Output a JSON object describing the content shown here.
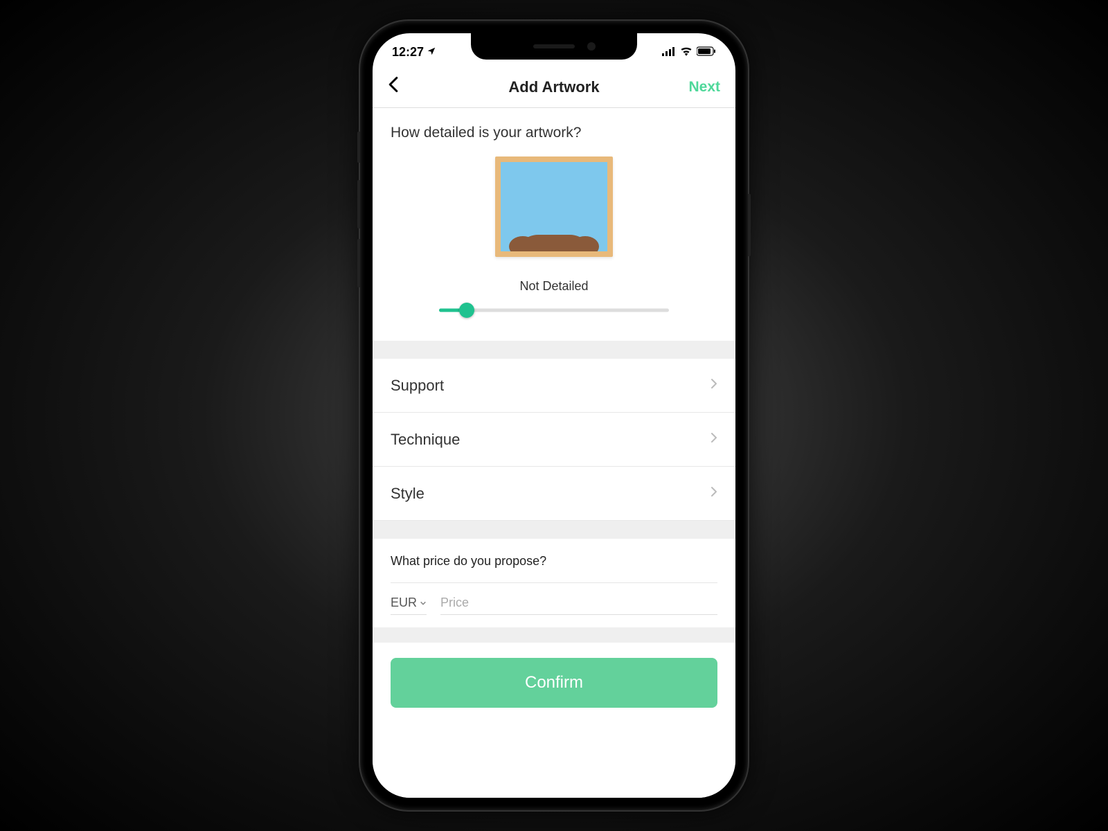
{
  "status": {
    "time": "12:27",
    "location_icon": "location-arrow-icon",
    "signal_icon": "cellular-signal-icon",
    "wifi_icon": "wifi-icon",
    "battery_icon": "battery-icon"
  },
  "nav": {
    "back_icon": "chevron-left-icon",
    "title": "Add Artwork",
    "next_label": "Next"
  },
  "detail": {
    "question": "How detailed is your artwork?",
    "slider_label": "Not Detailed",
    "slider_percent": 12
  },
  "rows": [
    {
      "label": "Support",
      "key": "support"
    },
    {
      "label": "Technique",
      "key": "technique"
    },
    {
      "label": "Style",
      "key": "style"
    }
  ],
  "price": {
    "question": "What price do you propose?",
    "currency": "EUR",
    "placeholder": "Price",
    "value": ""
  },
  "confirm_label": "Confirm",
  "colors": {
    "accent": "#4fd89a",
    "slider": "#1fc28f",
    "button": "#63d19b"
  }
}
